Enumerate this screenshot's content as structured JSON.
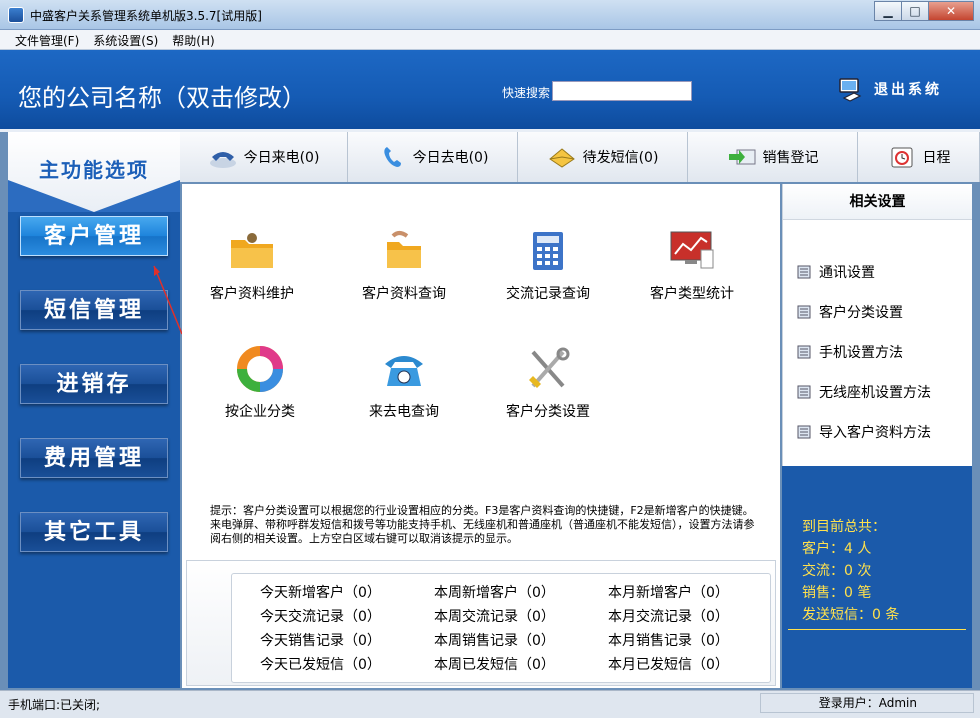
{
  "window": {
    "title": "中盛客户关系管理系统单机版3.5.7[试用版]",
    "min": "▁",
    "max": "□",
    "close": "✕"
  },
  "menu": [
    "文件管理(F)",
    "系统设置(S)",
    "帮助(H)"
  ],
  "header": {
    "company": "您的公司名称（双击修改）",
    "search_label": "快速搜索",
    "search_value": "",
    "exit_label": "退出系统"
  },
  "sidebar": {
    "title": "主功能选项",
    "items": [
      {
        "label": "客户管理",
        "active": true
      },
      {
        "label": "短信管理",
        "active": false
      },
      {
        "label": "进销存",
        "active": false
      },
      {
        "label": "费用管理",
        "active": false
      },
      {
        "label": "其它工具",
        "active": false
      }
    ]
  },
  "tabs": [
    {
      "label": "今日来电(0)",
      "icon": "phone-icon"
    },
    {
      "label": "今日去电(0)",
      "icon": "handset-icon"
    },
    {
      "label": "待发短信(0)",
      "icon": "envelope-icon"
    },
    {
      "label": "销售登记",
      "icon": "arrow-mail-icon"
    },
    {
      "label": "日程",
      "icon": "calendar-clock-icon"
    }
  ],
  "functions": [
    {
      "label": "客户资料维护",
      "icon": "folder-users-icon"
    },
    {
      "label": "客户资料查询",
      "icon": "folder-search-icon"
    },
    {
      "label": "交流记录查询",
      "icon": "calculator-icon"
    },
    {
      "label": "客户类型统计",
      "icon": "chart-monitor-icon"
    },
    {
      "label": "按企业分类",
      "icon": "color-ring-icon"
    },
    {
      "label": "来去电查询",
      "icon": "telephone-icon"
    },
    {
      "label": "客户分类设置",
      "icon": "tools-icon"
    }
  ],
  "hint": "提示：客户分类设置可以根据您的行业设置相应的分类。F3是客户资料查询的快捷键，F2是新增客户的快捷键。来电弹屏、带称呼群发短信和拨号等功能支持手机、无线座机和普通座机（普通座机不能发短信），设置方法请参阅右侧的相关设置。上方空白区域右键可以取消该提示的显示。",
  "stats": [
    [
      "今天新增客户（0）",
      "本周新增客户（0）",
      "本月新增客户（0）"
    ],
    [
      "今天交流记录（0）",
      "本周交流记录（0）",
      "本月交流记录（0）"
    ],
    [
      "今天销售记录（0）",
      "本周销售记录（0）",
      "本月销售记录（0）"
    ],
    [
      "今天已发短信（0）",
      "本周已发短信（0）",
      "本月已发短信（0）"
    ]
  ],
  "settings": {
    "title": "相关设置",
    "items": [
      "通讯设置",
      "客户分类设置",
      "手机设置方法",
      "无线座机设置方法",
      "导入客户资料方法"
    ]
  },
  "summary": [
    "到目前总共：",
    "客户：4 人",
    "交流：0 次",
    "销售：0 笔",
    "发送短信：0 条"
  ],
  "status": {
    "left": "手机端口:已关闭;",
    "right": "登录用户：Admin"
  },
  "colors": {
    "header_blue": "#1d68c4",
    "sidebar_blue": "#1b5aaa",
    "active_blue": "#1e84dc",
    "summary_yellow": "#ffe14d"
  }
}
